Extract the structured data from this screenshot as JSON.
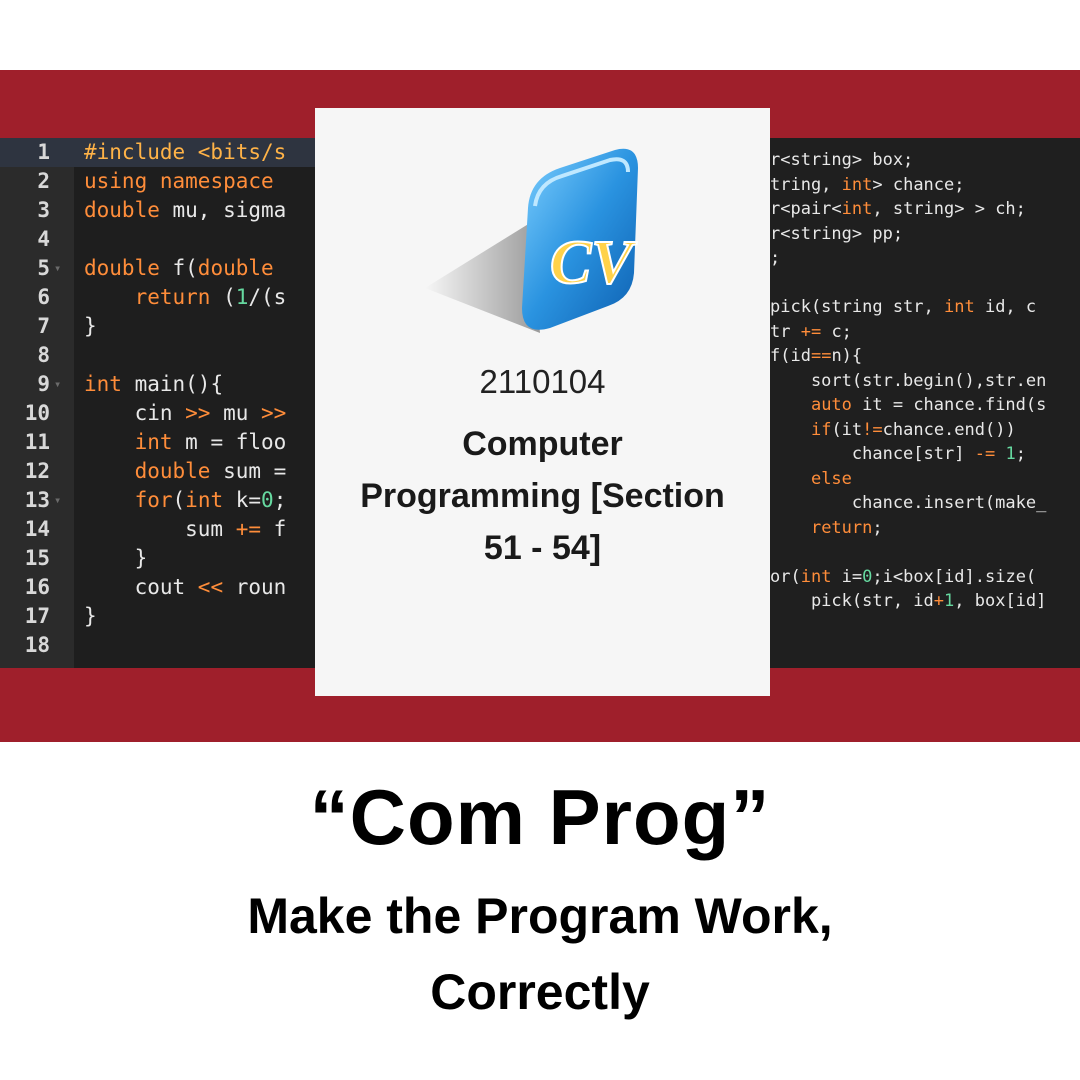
{
  "left_editor": {
    "lines": [
      {
        "n": "1",
        "code": "#include <bits/s"
      },
      {
        "n": "2",
        "code": "using namespace"
      },
      {
        "n": "3",
        "code": "double mu, sigma"
      },
      {
        "n": "4",
        "code": ""
      },
      {
        "n": "5",
        "code": "double f(double"
      },
      {
        "n": "6",
        "code": "    return (1/(s"
      },
      {
        "n": "7",
        "code": "}"
      },
      {
        "n": "8",
        "code": ""
      },
      {
        "n": "9",
        "code": "int main(){"
      },
      {
        "n": "10",
        "code": "    cin >> mu >>"
      },
      {
        "n": "11",
        "code": "    int m = floo"
      },
      {
        "n": "12",
        "code": "    double sum ="
      },
      {
        "n": "13",
        "code": "    for(int k=0;"
      },
      {
        "n": "14",
        "code": "        sum += f"
      },
      {
        "n": "15",
        "code": "    }"
      },
      {
        "n": "16",
        "code": "    cout << roun"
      },
      {
        "n": "17",
        "code": "}"
      },
      {
        "n": "18",
        "code": ""
      }
    ]
  },
  "right_editor": {
    "lines": [
      "r<string> box;",
      "tring, int> chance;",
      "r<pair<int, string> > ch;",
      "r<string> pp;",
      ";",
      "",
      "pick(string str, int id, c",
      "tr += c;",
      "f(id==n){",
      "    sort(str.begin(),str.en",
      "    auto it = chance.find(s",
      "    if(it!=chance.end())",
      "        chance[str] -= 1;",
      "    else",
      "        chance.insert(make_",
      "    return;",
      "",
      "or(int i=0;i<box[id].size(",
      "    pick(str, id+1, box[id]"
    ]
  },
  "card": {
    "logo_icon": "cv-logo-icon",
    "course_code": "2110104",
    "course_name_lines": [
      "Computer",
      "Programming [Section",
      "51 - 54]"
    ]
  },
  "headline": "“Com Prog”",
  "subline_lines": [
    "Make the Program Work,",
    "Correctly"
  ],
  "colors": {
    "band": "#9f1f2b",
    "editor_bg": "#1e1e1e",
    "keyword": "#ff8d3a",
    "number": "#66d9a0"
  }
}
